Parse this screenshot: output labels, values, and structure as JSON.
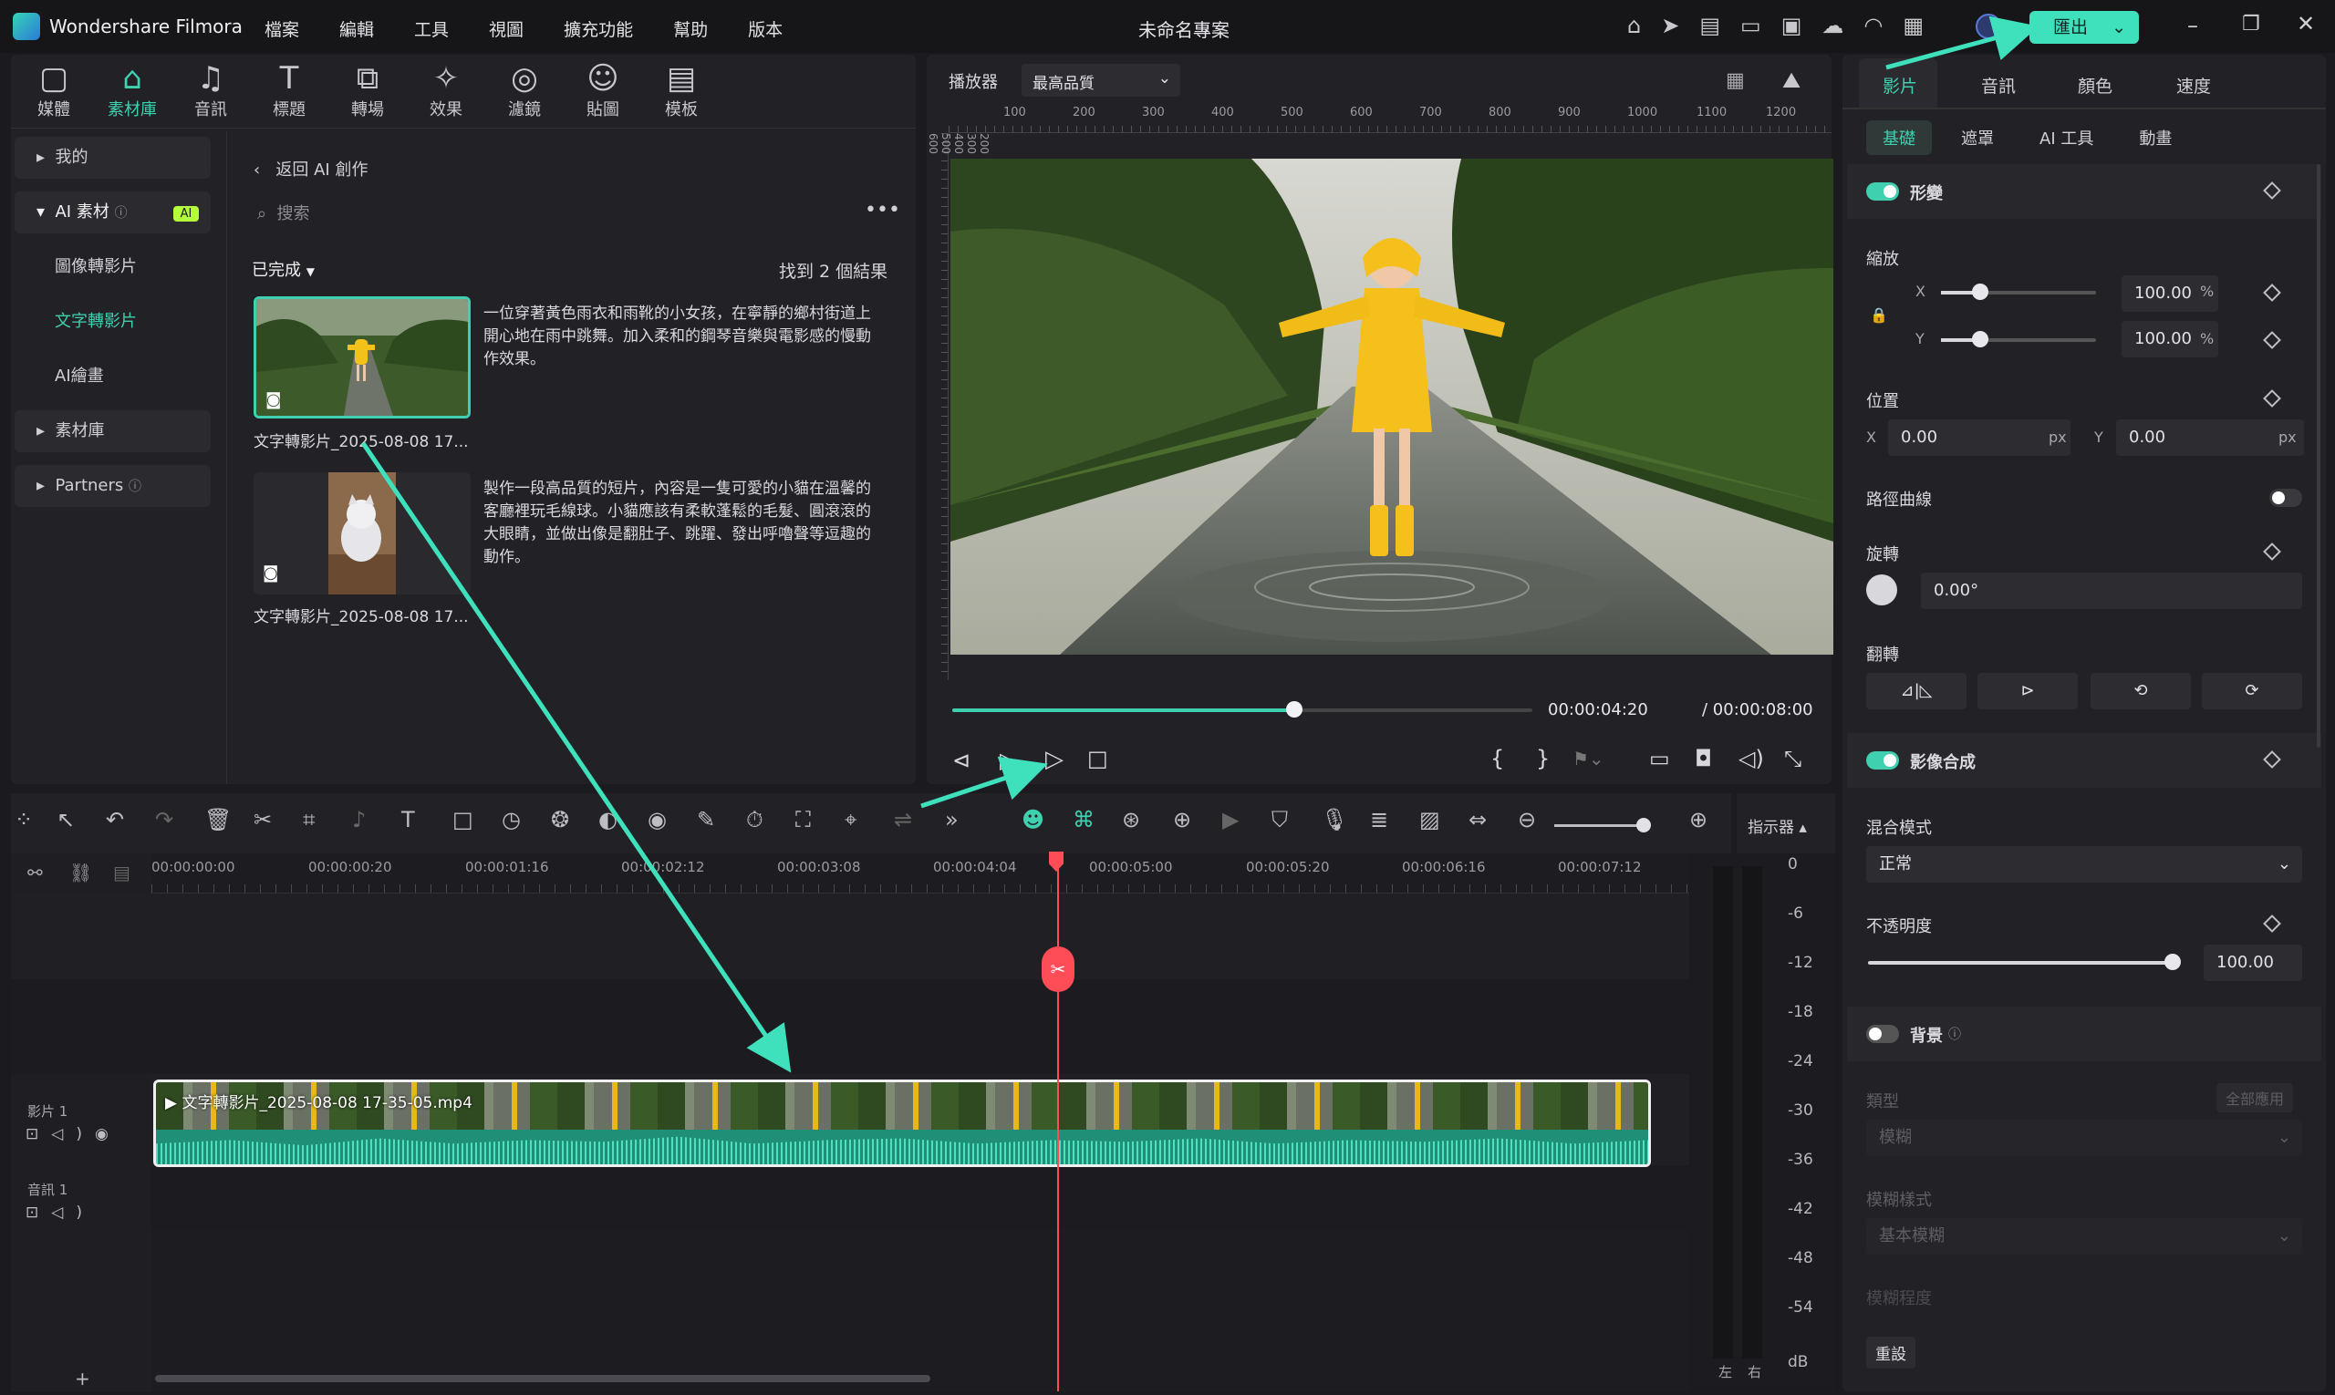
{
  "app": {
    "name": "Wondershare Filmora",
    "project_title": "未命名專案",
    "export_label": "匯出"
  },
  "menu": [
    "檔案",
    "編輯",
    "工具",
    "視圖",
    "擴充功能",
    "幫助",
    "版本"
  ],
  "toolbar": [
    {
      "label": "媒體",
      "icon": "media-icon"
    },
    {
      "label": "素材庫",
      "icon": "library-icon",
      "active": true
    },
    {
      "label": "音訊",
      "icon": "music-icon"
    },
    {
      "label": "標題",
      "icon": "title-icon"
    },
    {
      "label": "轉場",
      "icon": "transition-icon"
    },
    {
      "label": "效果",
      "icon": "effects-icon"
    },
    {
      "label": "濾鏡",
      "icon": "filter-icon"
    },
    {
      "label": "貼圖",
      "icon": "sticker-icon"
    },
    {
      "label": "模板",
      "icon": "template-icon"
    }
  ],
  "sidebar": {
    "my": "我的",
    "ai_assets": "AI 素材",
    "ai_badge": "AI",
    "sub_items": [
      "圖像轉影片",
      "文字轉影片",
      "AI繪畫"
    ],
    "library": "素材庫",
    "partners": "Partners"
  },
  "library": {
    "back_label": "返回 AI 創作",
    "search_placeholder": "搜索",
    "filter_label": "已完成",
    "results_label": "找到 2 個結果",
    "items": [
      {
        "title": "文字轉影片_2025-08-08 17...",
        "desc": "一位穿著黃色雨衣和雨靴的小女孩，在寧靜的鄉村街道上開心地在雨中跳舞。加入柔和的鋼琴音樂與電影感的慢動作效果。"
      },
      {
        "title": "文字轉影片_2025-08-08 17...",
        "desc": "製作一段高品質的短片，內容是一隻可愛的小貓在溫馨的客廳裡玩毛線球。小貓應該有柔軟蓬鬆的毛髮、圓滾滾的大眼睛，並做出像是翻肚子、跳躍、發出呼嚕聲等逗趣的動作。"
      }
    ]
  },
  "player": {
    "label": "播放器",
    "quality": "最高品質",
    "ruler_ticks": [
      "100",
      "200",
      "300",
      "400",
      "500",
      "600",
      "700",
      "800",
      "900",
      "1000",
      "1100",
      "1200"
    ],
    "ruler_v_ticks": [
      "100",
      "200",
      "300",
      "400",
      "500",
      "600"
    ],
    "current_time": "00:00:04:20",
    "total_time": "/ 00:00:08:00",
    "progress": 0.59
  },
  "props": {
    "tabs": [
      "影片",
      "音訊",
      "顏色",
      "速度"
    ],
    "sub_tabs": [
      "基礎",
      "遮罩",
      "AI 工具",
      "動畫"
    ],
    "transform": "形變",
    "scale": "縮放",
    "scale_x_label": "X",
    "scale_y_label": "Y",
    "scale_x": "100.00",
    "scale_y": "100.00",
    "percent": "%",
    "position": "位置",
    "pos_x_label": "X",
    "pos_y_label": "Y",
    "pos_x": "0.00",
    "pos_y": "0.00",
    "px": "px",
    "path_curve": "路徑曲線",
    "rotate": "旋轉",
    "rotate_val": "0.00°",
    "flip": "翻轉",
    "compositing": "影像合成",
    "blend_mode": "混合模式",
    "blend_val": "正常",
    "opacity": "不透明度",
    "opacity_val": "100.00",
    "background": "背景",
    "type": "類型",
    "apply_all": "全部應用",
    "type_val": "模糊",
    "blur_style": "模糊樣式",
    "blur_style_val": "基本模糊",
    "blur_degree": "模糊程度",
    "reset": "重設"
  },
  "timeline": {
    "indicator_label": "指示器",
    "ruler": [
      "00:00:00:00",
      "00:00:00:20",
      "00:00:01:16",
      "00:00:02:12",
      "00:00:03:08",
      "00:00:04:04",
      "00:00:05:00",
      "00:00:05:20",
      "00:00:06:16",
      "00:00:07:12"
    ],
    "video_track": "影片 1",
    "audio_track": "音訊 1",
    "clip_name": "文字轉影片_2025-08-08 17-35-05.mp4",
    "db_scale": [
      "0",
      "-6",
      "-12",
      "-18",
      "-24",
      "-30",
      "-36",
      "-42",
      "-48",
      "-54",
      "dB"
    ],
    "left": "左",
    "right": "右"
  },
  "colors": {
    "accent": "#3fd0b0",
    "playhead": "#ff4d57",
    "background": "#1b1b1f"
  }
}
